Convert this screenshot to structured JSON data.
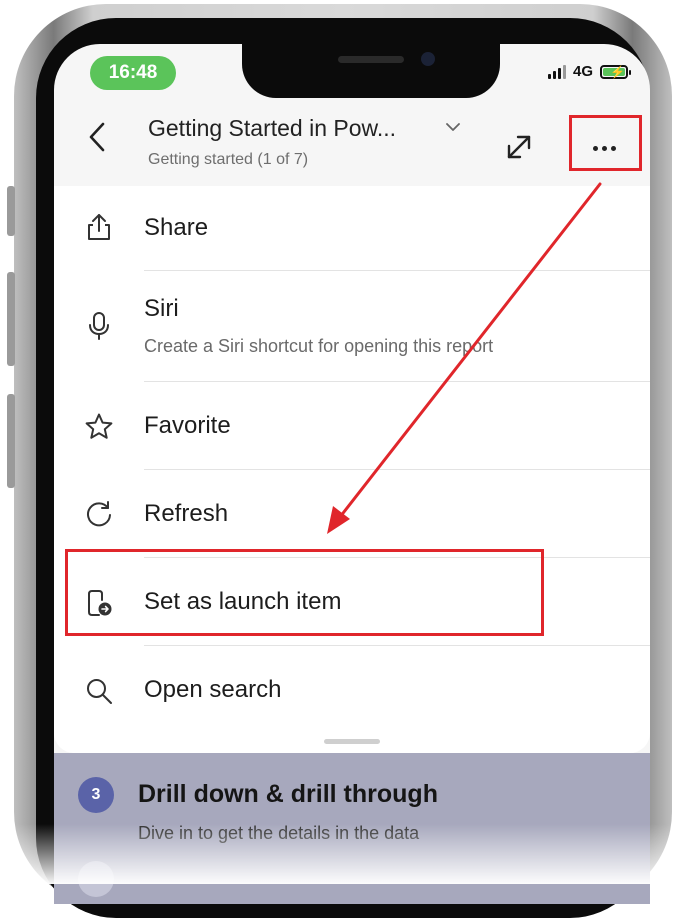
{
  "status_bar": {
    "time": "16:48",
    "network": "4G"
  },
  "header": {
    "title": "Getting Started in Pow...",
    "subtitle": "Getting started (1 of 7)"
  },
  "menu": {
    "items": [
      {
        "label": "Share",
        "icon": "share-icon"
      },
      {
        "label": "Siri",
        "sublabel": "Create a Siri shortcut for opening this report",
        "icon": "microphone-icon"
      },
      {
        "label": "Favorite",
        "icon": "star-icon"
      },
      {
        "label": "Refresh",
        "icon": "refresh-icon"
      },
      {
        "label": "Set as launch item",
        "icon": "launch-item-icon"
      },
      {
        "label": "Open search",
        "icon": "search-icon"
      }
    ]
  },
  "background_steps": [
    {
      "number": "3",
      "title": "Drill down & drill through",
      "description": "Dive in to get the details in the data"
    }
  ],
  "colors": {
    "annotation": "#e0262b",
    "step_badge": "#5a63a8",
    "status_time_bg": "#5bc45a"
  }
}
